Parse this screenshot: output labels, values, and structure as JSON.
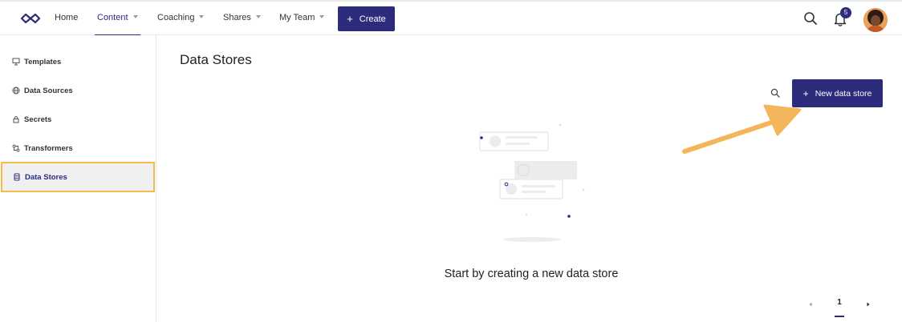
{
  "nav": {
    "items": [
      {
        "label": "Home",
        "caret": false,
        "active": false
      },
      {
        "label": "Content",
        "caret": true,
        "active": true
      },
      {
        "label": "Coaching",
        "caret": true,
        "active": false
      },
      {
        "label": "Shares",
        "caret": true,
        "active": false
      },
      {
        "label": "My Team",
        "caret": true,
        "active": false
      }
    ],
    "create_label": "Create",
    "notification_count": "5",
    "icons": {
      "logo": "infinity-logo-icon",
      "search": "search-icon",
      "bell": "bell-icon",
      "create": "plus-icon"
    }
  },
  "sidebar": {
    "items": [
      {
        "label": "Templates",
        "icon": "presentation-icon"
      },
      {
        "label": "Data Sources",
        "icon": "globe-icon"
      },
      {
        "label": "Secrets",
        "icon": "lock-icon"
      },
      {
        "label": "Transformers",
        "icon": "transform-icon"
      },
      {
        "label": "Data Stores",
        "icon": "database-icon",
        "active": true
      }
    ]
  },
  "main": {
    "title": "Data Stores",
    "new_button_label": "New data store",
    "empty_state_text": "Start by creating a new data store",
    "pagination": {
      "current_page": "1"
    }
  },
  "colors": {
    "accent": "#2c2b7c",
    "highlight": "#f5b94e",
    "arrow": "#f3b65a"
  }
}
